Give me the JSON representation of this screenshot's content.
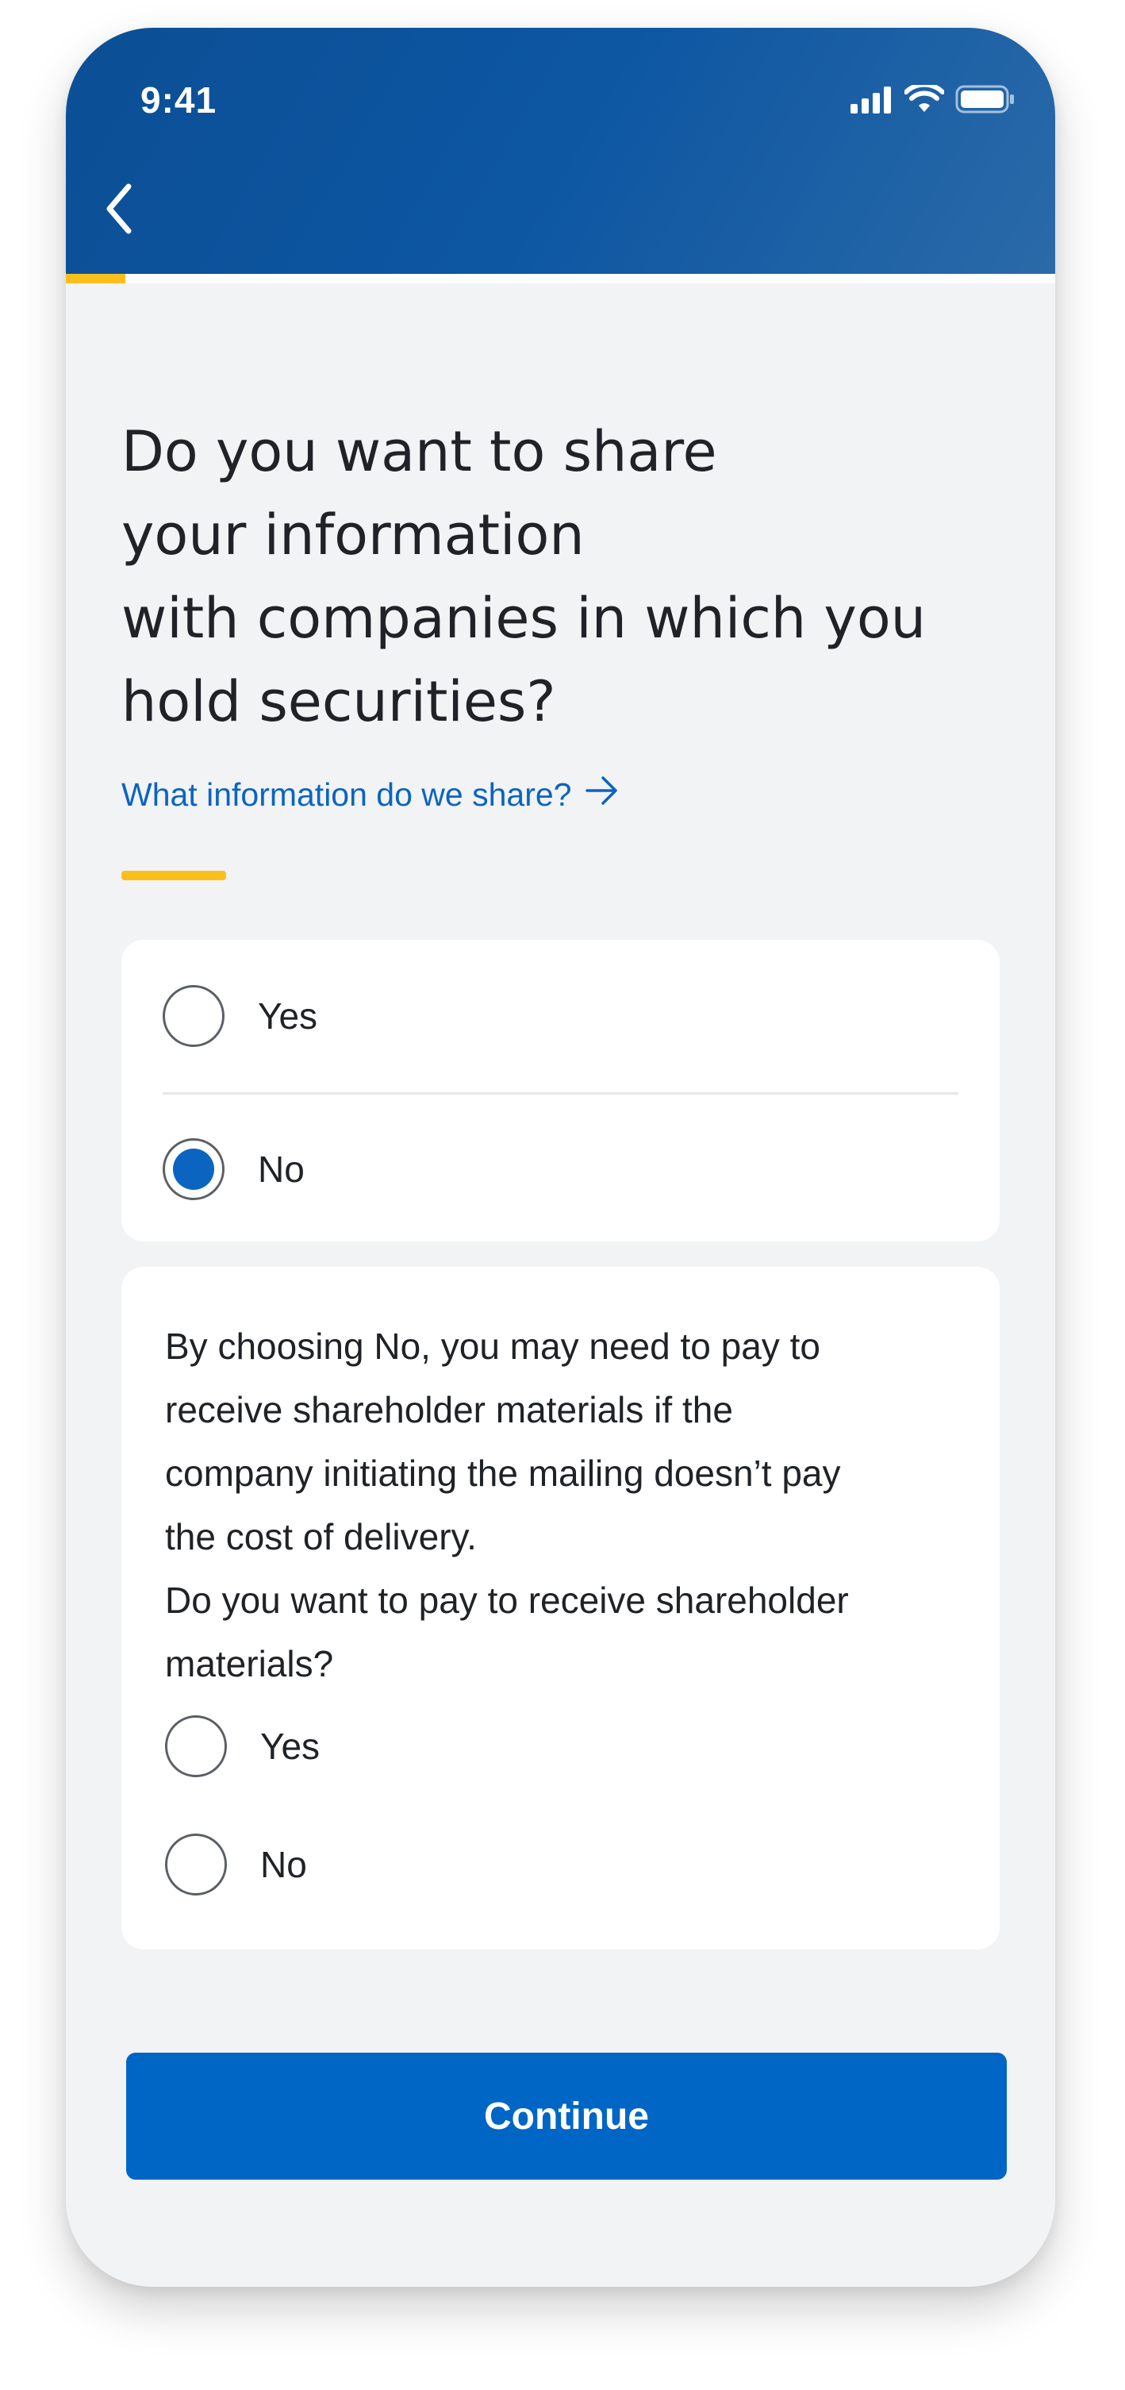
{
  "status_bar": {
    "time": "9:41",
    "icons": [
      "signal-icon",
      "wifi-icon",
      "battery-icon"
    ]
  },
  "header": {
    "back_icon": "chevron-left-icon",
    "progress_fraction": 0.06
  },
  "question": {
    "line1": "Do you want to share",
    "line2": "your information",
    "line3": "with companies in which you",
    "line4": "hold securities?"
  },
  "info_link": {
    "label": "What information do we share?",
    "icon": "arrow-right-icon"
  },
  "share_options": [
    {
      "label": "Yes",
      "selected": false
    },
    {
      "label": "No",
      "selected": true
    }
  ],
  "note": {
    "line1": "By choosing No, you may need to pay to",
    "line2": "receive shareholder materials if the",
    "line3": "company initiating the mailing doesn’t pay",
    "line4": "the cost of delivery.",
    "line5": "Do you want to pay to receive shareholder",
    "line6": "materials?"
  },
  "pay_options": [
    {
      "label": "Yes",
      "selected": false
    },
    {
      "label": "No",
      "selected": false
    }
  ],
  "continue_label": "Continue",
  "colors": {
    "header_blue": "#0d56a2",
    "accent_yellow": "#fbbf1c",
    "primary_blue": "#0066c6",
    "link_blue": "#0b64c0",
    "background": "#f2f3f5"
  }
}
